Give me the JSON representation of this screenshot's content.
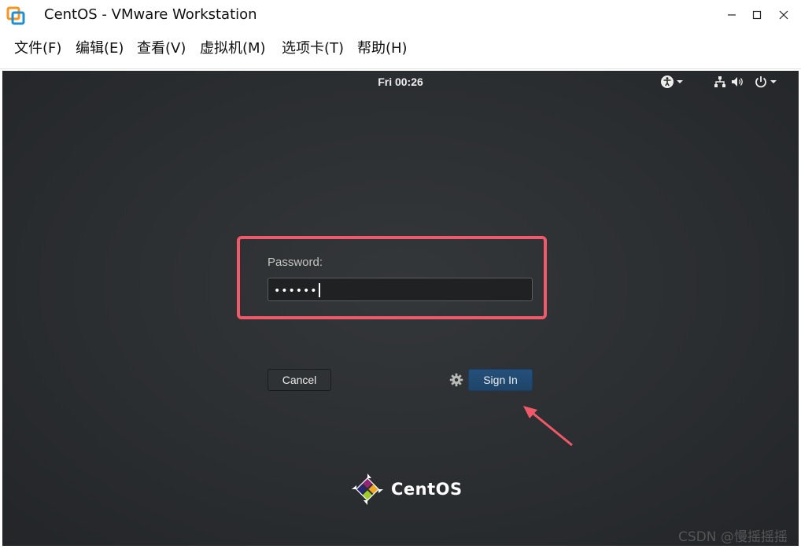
{
  "window": {
    "title": "CentOS - VMware Workstation"
  },
  "menu": [
    {
      "label": "文件(F)"
    },
    {
      "label": "编辑(E)"
    },
    {
      "label": "查看(V)"
    },
    {
      "label": "虚拟机(M)"
    },
    {
      "label": "选项卡(T)"
    },
    {
      "label": "帮助(H)"
    }
  ],
  "vm": {
    "clock": "Fri 00:26",
    "login": {
      "password_label": "Password:",
      "password_value": "••••••",
      "cancel_label": "Cancel",
      "signin_label": "Sign In"
    },
    "logo_text": "CentOS"
  },
  "watermark": "CSDN @慢摇摇摇",
  "colors": {
    "highlight": "#f0596a",
    "desktop_bg": "#2b2e31",
    "signin_bg": "#24507a"
  },
  "icons": [
    "vmware-icon",
    "minimize-icon",
    "maximize-icon",
    "close-icon",
    "accessibility-icon",
    "network-icon",
    "volume-icon",
    "power-icon",
    "gear-icon",
    "centos-logo-icon"
  ]
}
